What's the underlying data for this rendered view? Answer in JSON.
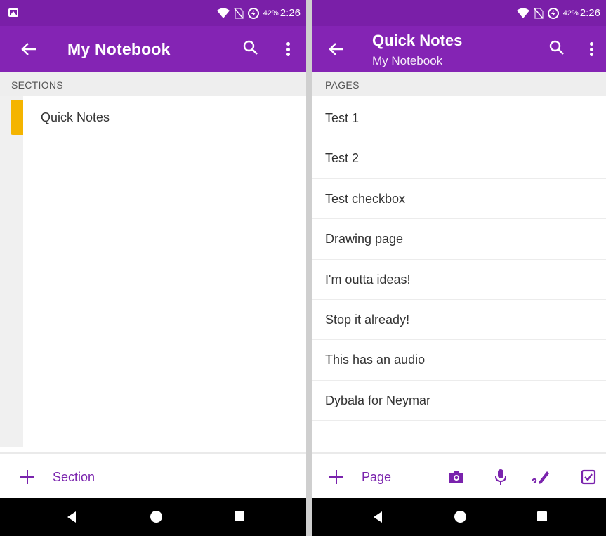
{
  "colors": {
    "status_bar": "#7a1fa8",
    "app_bar": "#8424b4",
    "accent": "#7a23ad",
    "section_tab": "#f4b400",
    "subheader_bg": "#eeeeee",
    "nav_bar": "#000000"
  },
  "left": {
    "status": {
      "battery": "42%",
      "time": "2:26"
    },
    "app_bar": {
      "title": "My Notebook"
    },
    "subheader": "SECTIONS",
    "sections": [
      {
        "label": "Quick Notes",
        "color": "#f4b400"
      }
    ],
    "bottom": {
      "add_label": "Section"
    }
  },
  "right": {
    "status": {
      "battery": "42%",
      "time": "2:26"
    },
    "app_bar": {
      "title": "Quick Notes",
      "subtitle": "My Notebook"
    },
    "subheader": "PAGES",
    "pages": [
      {
        "label": "Test 1"
      },
      {
        "label": "Test 2"
      },
      {
        "label": "Test checkbox"
      },
      {
        "label": "Drawing page"
      },
      {
        "label": "I'm outta ideas!"
      },
      {
        "label": "Stop it already!"
      },
      {
        "label": "This has an audio"
      },
      {
        "label": "Dybala for Neymar"
      }
    ],
    "bottom": {
      "add_label": "Page",
      "tools": [
        "camera-icon",
        "microphone-icon",
        "ink-pen-icon",
        "checkbox-icon"
      ]
    }
  }
}
